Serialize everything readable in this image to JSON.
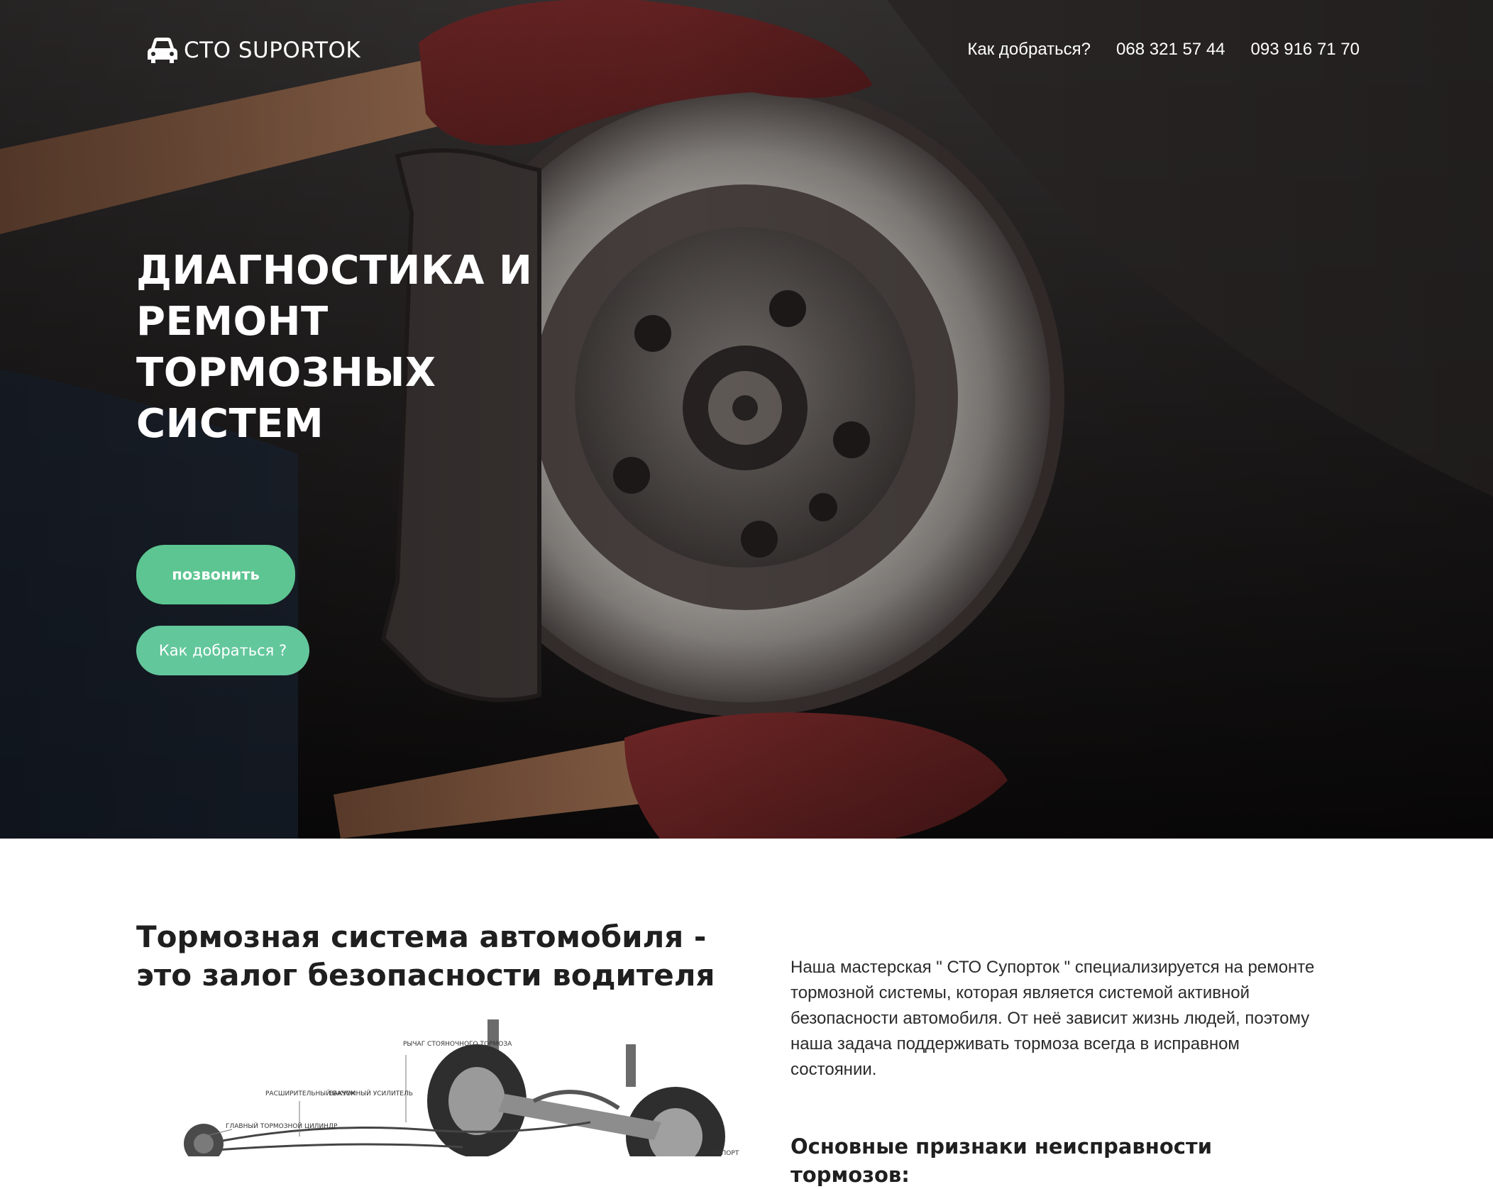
{
  "header": {
    "logo_text": "СТО SUPORTOK",
    "nav": [
      {
        "label": "Как добраться?"
      },
      {
        "label": "068 321 57 44"
      },
      {
        "label": "093 916 71 70"
      }
    ]
  },
  "hero": {
    "title": "ДИАГНОСТИКА И РЕМОНТ ТОРМОЗНЫХ СИСТЕМ",
    "call_button": "позвонить",
    "route_button": "Как добраться ?"
  },
  "section": {
    "title": "Тормозная система автомобиля - это залог безопасности водителя",
    "intro": "Наша мастерская \" СТО Супорток \" специализируется на ремонте тормозной системы, которая является системой активной безопасности автомобиля. От неё зависит жизнь людей, поэтому наша задача поддерживать тормоза всегда в исправном состоянии.",
    "subheading": "Основные признаки неисправности тормозов:",
    "diagram_labels": {
      "parking_lever": "РЫЧАГ СТОЯНОЧНОГО ТОРМОЗА",
      "expansion_tank": "РАСШИРИТЕЛЬНЫЙ БАЧОК",
      "vacuum_booster": "ВАКУУМНЫЙ УСИЛИТЕЛЬ",
      "master_cylinder": "ГЛАВНЫЙ ТОРМОЗНОЙ ЦИЛИНДР",
      "caliper": "СУППОРТ"
    }
  },
  "colors": {
    "accent_green": "#5cc591",
    "accent_green_light": "#63c79c",
    "hero_dark": "#1a1616"
  }
}
